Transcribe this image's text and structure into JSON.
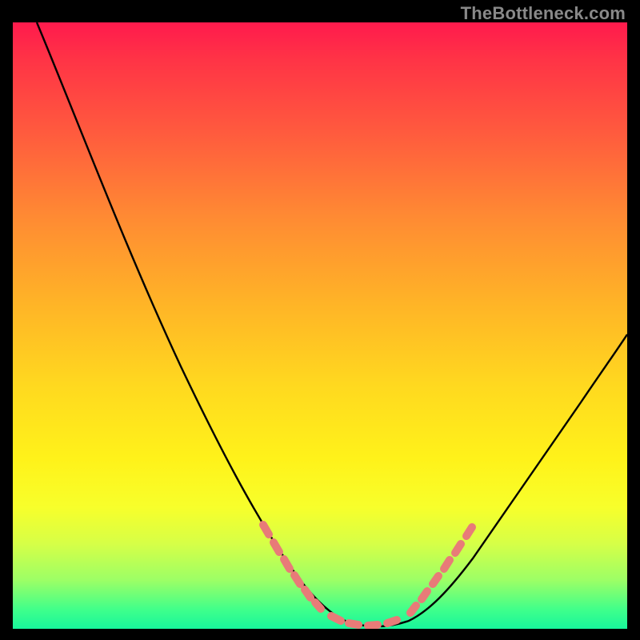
{
  "attribution": "TheBottleneck.com",
  "chart_data": {
    "type": "line",
    "title": "",
    "xlabel": "",
    "ylabel": "",
    "xlim": [
      0,
      100
    ],
    "ylim": [
      0,
      100
    ],
    "series": [
      {
        "name": "bottleneck-curve",
        "x": [
          4,
          8,
          12,
          16,
          20,
          24,
          28,
          32,
          36,
          40,
          44,
          48,
          50,
          52,
          54,
          56,
          58,
          60,
          62,
          64,
          68,
          72,
          76,
          80,
          84,
          88,
          92,
          96,
          100
        ],
        "y": [
          100,
          91,
          82,
          73,
          65,
          57,
          49,
          42,
          35,
          28,
          22,
          16,
          13,
          10,
          7,
          5,
          3,
          2,
          1,
          1,
          2,
          5,
          10,
          17,
          25,
          33,
          41,
          49,
          57
        ]
      }
    ],
    "highlight_segments": [
      {
        "name": "left-highlight",
        "x": [
          42,
          52
        ],
        "y": [
          25,
          10
        ]
      },
      {
        "name": "valley-highlight",
        "x": [
          54,
          64
        ],
        "y": [
          3,
          1
        ]
      },
      {
        "name": "right-highlight",
        "x": [
          66,
          74
        ],
        "y": [
          2,
          10
        ]
      }
    ],
    "gradient_stops": [
      {
        "pos": 0,
        "color": "#ff1a4d"
      },
      {
        "pos": 18,
        "color": "#ff5a3e"
      },
      {
        "pos": 46,
        "color": "#ffb327"
      },
      {
        "pos": 72,
        "color": "#fff21a"
      },
      {
        "pos": 92,
        "color": "#9cff66"
      },
      {
        "pos": 100,
        "color": "#18f59b"
      }
    ]
  }
}
